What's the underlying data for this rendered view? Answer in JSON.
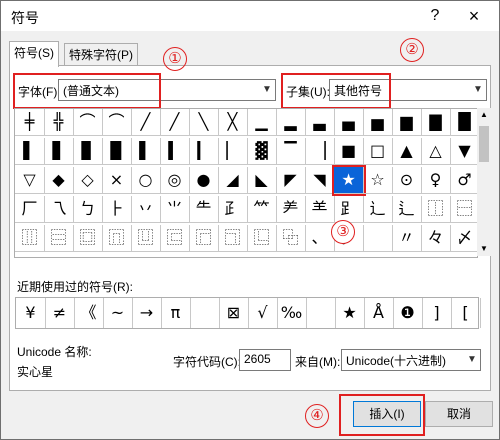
{
  "title": "符号",
  "help": "?",
  "close": "×",
  "tabs": [
    "符号(S)",
    "特殊字符(P)"
  ],
  "font_label": "字体(F):",
  "font_value": "(普通文本)",
  "subset_label": "子集(U):",
  "subset_value": "其他符号",
  "grid": [
    [
      "╪",
      "╬",
      "⌒",
      "⌒",
      "╱",
      "╱",
      "╲",
      "╳",
      "▁",
      "▂",
      "▃",
      "▄",
      "▅",
      "▆",
      "▇",
      "█"
    ],
    [
      "▌",
      "▋",
      "▊",
      "▉",
      "▌",
      "▍",
      "▎",
      "▏",
      "▓",
      "▔",
      "▕",
      "■",
      "□",
      "▲",
      "△",
      "▼"
    ],
    [
      "▽",
      "◆",
      "◇",
      "×",
      "○",
      "◎",
      "●",
      "◢",
      "◣",
      "◤",
      "◥",
      "★",
      "☆",
      "⊙",
      "♀",
      "♂"
    ],
    [
      "厂",
      "乁",
      "ㄅ",
      "⺊",
      "丷",
      "⺌",
      "⺧",
      "⺪",
      "⺮",
      "⺶",
      "⺷",
      "⻊",
      "⻌",
      "⻍",
      "⿰",
      "⿱"
    ],
    [
      "⿲",
      "⿳",
      "⿴",
      "⿵",
      "⿶",
      "⿷",
      "⿸",
      "⿹",
      "⿺",
      "⿻",
      "、",
      "。",
      "",
      "〃",
      "々",
      "〆"
    ]
  ],
  "selected_char": "★",
  "recent_label": "近期使用过的符号(R):",
  "recent": [
    "¥",
    "≠",
    "《",
    "~",
    "→",
    "π",
    "",
    "⊠",
    "√",
    "‰",
    "",
    "★",
    "Å",
    "❶",
    "]",
    "["
  ],
  "unicode_name_label": "Unicode 名称:",
  "unicode_name": "实心星",
  "char_code_label": "字符代码(C):",
  "char_code": "2605",
  "from_label": "来自(M):",
  "from_value": "Unicode(十六进制)",
  "insert_label": "插入(I)",
  "cancel_label": "取消",
  "annotations": [
    "①",
    "②",
    "③",
    "④"
  ],
  "colors": {
    "accent": "#0a64d8",
    "annotation": "#e02020"
  }
}
